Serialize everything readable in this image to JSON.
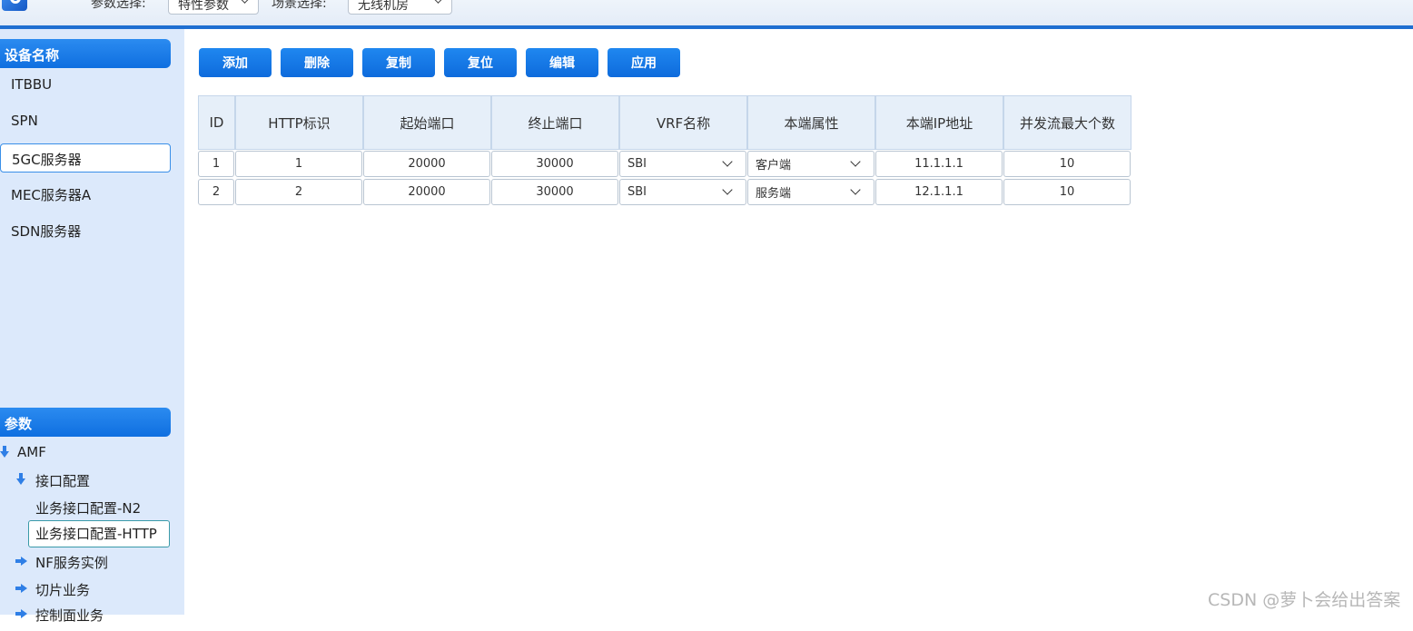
{
  "topbar": {
    "param_label": "参数选择:",
    "param_value": "特性参数",
    "scene_label": "场景选择:",
    "scene_value": "无线机房"
  },
  "sidebar": {
    "device_header": "设备名称",
    "devices": [
      {
        "label": "ITBBU"
      },
      {
        "label": "SPN"
      },
      {
        "label": "5GC服务器"
      },
      {
        "label": "MEC服务器A"
      },
      {
        "label": "SDN服务器"
      }
    ],
    "selected_device": "5GC服务器",
    "param_header": "参数",
    "tree": {
      "root": "AMF",
      "interface": "接口配置",
      "n2": "业务接口配置-N2",
      "http": "业务接口配置-HTTP",
      "nf": "NF服务实例",
      "slice": "切片业务",
      "control": "控制面业务"
    }
  },
  "toolbar": {
    "add": "添加",
    "delete": "删除",
    "copy": "复制",
    "reset": "复位",
    "edit": "编辑",
    "apply": "应用"
  },
  "table": {
    "headers": [
      "ID",
      "HTTP标识",
      "起始端口",
      "终止端口",
      "VRF名称",
      "本端属性",
      "本端IP地址",
      "并发流最大个数"
    ],
    "rows": [
      [
        "1",
        "1",
        "20000",
        "30000",
        "SBI",
        "客户端",
        "11.1.1.1",
        "10"
      ],
      [
        "2",
        "2",
        "20000",
        "30000",
        "SBI",
        "服务端",
        "12.1.1.1",
        "10"
      ]
    ]
  },
  "watermark": "CSDN @萝卜会给出答案",
  "colors": {
    "accent": "#1f6fd1",
    "button": "#0e6bdc",
    "sidebar_bg": "#dce9fb",
    "header_bg": "#e6eff9"
  }
}
